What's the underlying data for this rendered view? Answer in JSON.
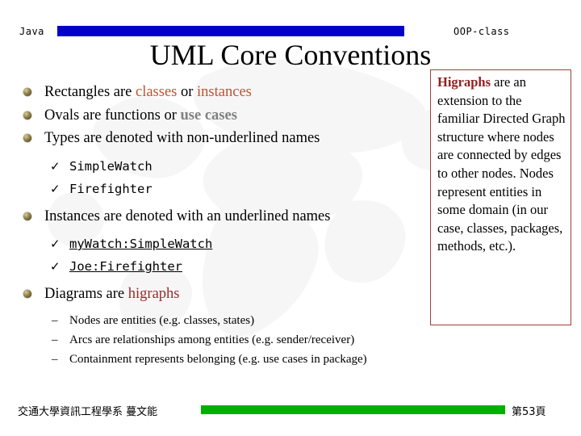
{
  "header": {
    "left_label": "Java",
    "right_label": "OOP-class",
    "bar_color": "#0000cc"
  },
  "title": "UML Core Conventions",
  "colors": {
    "accent_orange": "#c0522e",
    "accent_gray": "#808080",
    "accent_maroon": "#9b2b2b",
    "box_border": "#a83a3a",
    "header_bar": "#0000cc",
    "footer_bar": "#00b000",
    "bullet_sphere": "#6b6034"
  },
  "body": {
    "items": [
      {
        "level": 1,
        "bullet": "sphere-bullet",
        "segments": [
          {
            "text": "Rectangles are ",
            "style": "plain"
          },
          {
            "text": "classes",
            "style": "orange"
          },
          {
            "text": " or ",
            "style": "plain"
          },
          {
            "text": "instances",
            "style": "orange"
          }
        ]
      },
      {
        "level": 1,
        "bullet": "sphere-bullet",
        "segments": [
          {
            "text": "Ovals are functions or ",
            "style": "plain"
          },
          {
            "text": "use cases",
            "style": "gray"
          }
        ]
      },
      {
        "level": 1,
        "bullet": "sphere-bullet",
        "segments": [
          {
            "text": "Types are denoted with non-underlined names",
            "style": "plain"
          }
        ]
      },
      {
        "level": 2,
        "bullet": "check-mark",
        "mono": true,
        "underline": false,
        "text": "SimpleWatch"
      },
      {
        "level": 2,
        "bullet": "check-mark",
        "mono": true,
        "underline": false,
        "text": "Firefighter"
      },
      {
        "level": 1,
        "bullet": "sphere-bullet",
        "segments": [
          {
            "text": "Instances are denoted with an underlined names",
            "style": "plain"
          }
        ]
      },
      {
        "level": 2,
        "bullet": "check-mark",
        "mono": true,
        "underline": true,
        "text": "myWatch:SimpleWatch"
      },
      {
        "level": 2,
        "bullet": "check-mark",
        "mono": true,
        "underline": true,
        "text": "Joe:Firefighter"
      },
      {
        "level": 1,
        "bullet": "sphere-bullet",
        "segments": [
          {
            "text": "Diagrams are ",
            "style": "plain"
          },
          {
            "text": "higraphs",
            "style": "maroon"
          }
        ]
      },
      {
        "level": 3,
        "bullet": "dash",
        "text": "Nodes are entities (e.g. classes, states)"
      },
      {
        "level": 3,
        "bullet": "dash",
        "text": "Arcs are relationships among entities (e.g. sender/receiver)"
      },
      {
        "level": 3,
        "bullet": "dash",
        "text": "Containment represents belonging (e.g. use cases in package)"
      }
    ],
    "check_glyph": "✓",
    "dash_glyph": "–"
  },
  "side_box": {
    "lead_word": "Higraphs",
    "rest_text": " are an extension to the familiar Directed Graph structure where nodes are connected by edges to other nodes. Nodes represent entities in some domain (in our case, classes, packages, methods, etc.)."
  },
  "footer": {
    "left_label": "交通大學資訊工程學系 蔓文能",
    "right_label": "第53頁",
    "bar_color": "#00b000"
  }
}
